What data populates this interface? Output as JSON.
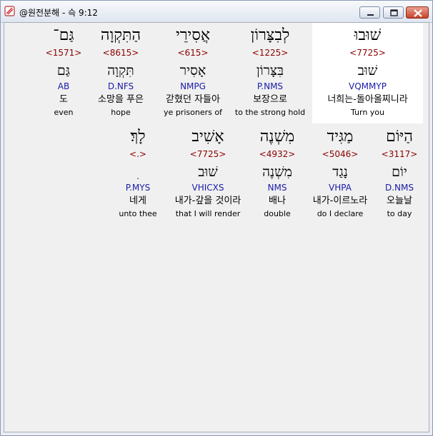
{
  "window": {
    "title": "@원전분해 - 슥 9:12"
  },
  "verse": {
    "rows": [
      [
        {
          "hebrew": "שׁוּבוּ",
          "strong": "<7725>",
          "lemma": "שׁוּב",
          "morph": "VQMMYP",
          "korean": "너희는-돌아올찌니라",
          "english": "Turn you",
          "selected": true
        },
        {
          "hebrew": "לְבִצָּרוֹן",
          "strong": "<1225>",
          "lemma": "בִּצָּרוֹן",
          "morph": "P.NMS",
          "korean": "보장으로",
          "english": "to the strong hold",
          "selected": false
        },
        {
          "hebrew": "אֲסִירֵי",
          "strong": "<615>",
          "lemma": "אָסִיר",
          "morph": "NMPG",
          "korean": "갇혔던 자들아",
          "english": "ye prisoners of",
          "selected": false
        },
        {
          "hebrew": "הַתִּקְוָה",
          "strong": "<8615>",
          "lemma": "תִּקְוָה",
          "morph": "D.NFS",
          "korean": "소망을 푸은",
          "english": "hope",
          "selected": false
        },
        {
          "hebrew": "גַּם־",
          "strong": "<1571>",
          "lemma": "גַּם",
          "morph": "AB",
          "korean": "도",
          "english": "even",
          "selected": false
        }
      ],
      [
        {
          "hebrew": "הַיּוֹם",
          "strong": "<3117>",
          "lemma": "יוֹם",
          "morph": "D.NMS",
          "korean": "오늘날",
          "english": "to day",
          "selected": false
        },
        {
          "hebrew": "מַגִּיד",
          "strong": "<5046>",
          "lemma": "נָגַד",
          "morph": "VHPA",
          "korean": "내가-이르노라",
          "english": "do I declare",
          "selected": false
        },
        {
          "hebrew": "מִשְׁנֶה",
          "strong": "<4932>",
          "lemma": "מִשְׁנֶה",
          "morph": "NMS",
          "korean": "배나",
          "english": "double",
          "selected": false
        },
        {
          "hebrew": "אָשִׁיב",
          "strong": "<7725>",
          "lemma": "שׁוּב",
          "morph": "VHICXS",
          "korean": "내가-갚을 것이라",
          "english": "that I will render",
          "selected": false
        },
        {
          "hebrew": "לָךְ׃",
          "strong": "<.>",
          "lemma": "ׅ",
          "morph": "P.MYS",
          "korean": "네게",
          "english": "unto thee",
          "selected": false
        }
      ]
    ]
  },
  "colors": {
    "strong": "#8b0000",
    "morph": "#1a1aa8",
    "selected_bg": "#ffffff"
  },
  "icons": {
    "app": "scroll-icon",
    "minimize": "minimize-icon",
    "maximize": "maximize-icon",
    "close": "close-icon"
  }
}
